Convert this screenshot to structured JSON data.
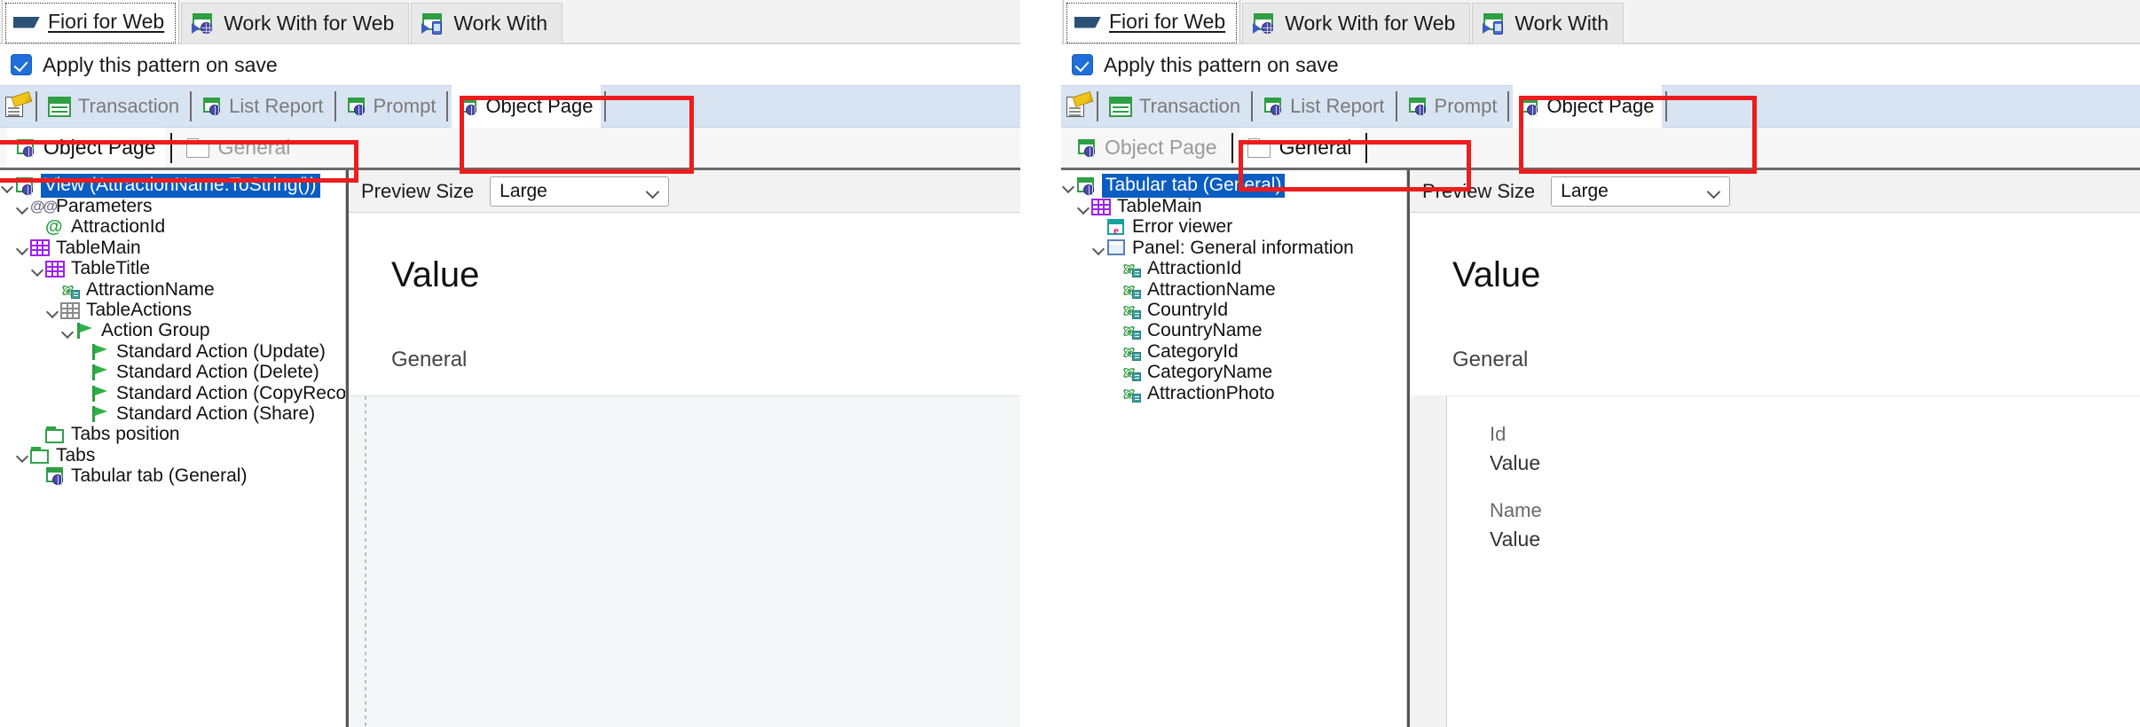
{
  "tabs": [
    {
      "label": "Fiori for Web",
      "icon": "fiori-icon",
      "active": true
    },
    {
      "label": "Work With for Web",
      "icon": "work-with-web-icon",
      "active": false
    },
    {
      "label": "Work With",
      "icon": "work-with-icon",
      "active": false
    }
  ],
  "checkbox": {
    "label": "Apply this pattern on save",
    "checked": true
  },
  "pattern_toolbar": {
    "settings_icon": "pattern-settings-icon",
    "items": [
      {
        "label": "Transaction",
        "icon": "transaction-grid-icon",
        "selected": false
      },
      {
        "label": "List Report",
        "icon": "list-report-icon",
        "selected": false
      },
      {
        "label": "Prompt",
        "icon": "prompt-icon",
        "selected": false
      },
      {
        "label": "Object Page",
        "icon": "object-page-icon",
        "selected": true
      }
    ]
  },
  "breadcrumb_left": [
    {
      "label": "Object Page",
      "icon": "object-page-icon",
      "active": true
    },
    {
      "label": "General",
      "icon": "folder-icon",
      "active": false
    }
  ],
  "breadcrumb_right": [
    {
      "label": "Object Page",
      "icon": "object-page-icon",
      "active": false
    },
    {
      "label": "General",
      "icon": "folder-icon",
      "active": true
    }
  ],
  "tree_left": [
    {
      "label": "View (AttractionName.ToString())",
      "icon": "object-page-icon",
      "indent": 0,
      "chevron": true,
      "selected": true
    },
    {
      "label": "Parameters",
      "icon": "parameters-icon",
      "indent": 1,
      "chevron": true,
      "selected": false
    },
    {
      "label": "AttractionId",
      "icon": "parameter-at-icon",
      "indent": 2,
      "chevron": false,
      "selected": false
    },
    {
      "label": "TableMain",
      "icon": "table-grid-icon",
      "indent": 1,
      "chevron": true,
      "selected": false
    },
    {
      "label": "TableTitle",
      "icon": "table-grid-icon",
      "indent": 2,
      "chevron": true,
      "selected": false
    },
    {
      "label": "AttractionName",
      "icon": "attribute-icon",
      "indent": 3,
      "chevron": false,
      "selected": false
    },
    {
      "label": "TableActions",
      "icon": "table-grid-gray-icon",
      "indent": 3,
      "chevron": true,
      "selected": false
    },
    {
      "label": "Action Group",
      "icon": "flag-icon",
      "indent": 4,
      "chevron": true,
      "selected": false
    },
    {
      "label": "Standard Action (Update)",
      "icon": "flag-icon",
      "indent": 5,
      "chevron": false,
      "selected": false
    },
    {
      "label": "Standard Action (Delete)",
      "icon": "flag-icon",
      "indent": 5,
      "chevron": false,
      "selected": false
    },
    {
      "label": "Standard Action (CopyRecor",
      "icon": "flag-icon",
      "indent": 5,
      "chevron": false,
      "selected": false
    },
    {
      "label": "Standard Action (Share)",
      "icon": "flag-icon",
      "indent": 5,
      "chevron": false,
      "selected": false
    },
    {
      "label": "Tabs position",
      "icon": "folder-green-icon",
      "indent": 2,
      "chevron": false,
      "selected": false
    },
    {
      "label": "Tabs",
      "icon": "folder-green-icon",
      "indent": 1,
      "chevron": true,
      "selected": false
    },
    {
      "label": "Tabular tab (General)",
      "icon": "object-page-icon",
      "indent": 2,
      "chevron": false,
      "selected": false
    }
  ],
  "tree_right": [
    {
      "label": "Tabular tab (General)",
      "icon": "object-page-icon",
      "indent": 0,
      "chevron": true,
      "selected": true
    },
    {
      "label": "TableMain",
      "icon": "table-grid-icon",
      "indent": 1,
      "chevron": true,
      "selected": false
    },
    {
      "label": "Error viewer",
      "icon": "error-viewer-icon",
      "indent": 2,
      "chevron": false,
      "selected": false
    },
    {
      "label": "Panel: General information",
      "icon": "panel-icon",
      "indent": 2,
      "chevron": true,
      "selected": false
    },
    {
      "label": "AttractionId",
      "icon": "attribute-icon",
      "indent": 3,
      "chevron": false,
      "selected": false
    },
    {
      "label": "AttractionName",
      "icon": "attribute-icon",
      "indent": 3,
      "chevron": false,
      "selected": false
    },
    {
      "label": "CountryId",
      "icon": "attribute-icon",
      "indent": 3,
      "chevron": false,
      "selected": false
    },
    {
      "label": "CountryName",
      "icon": "attribute-icon",
      "indent": 3,
      "chevron": false,
      "selected": false
    },
    {
      "label": "CategoryId",
      "icon": "attribute-icon",
      "indent": 3,
      "chevron": false,
      "selected": false
    },
    {
      "label": "CategoryName",
      "icon": "attribute-icon",
      "indent": 3,
      "chevron": false,
      "selected": false
    },
    {
      "label": "AttractionPhoto",
      "icon": "attribute-icon",
      "indent": 3,
      "chevron": false,
      "selected": false
    }
  ],
  "preview_left": {
    "size_label": "Preview Size",
    "size_value": "Large",
    "title": "Value",
    "section": "General"
  },
  "preview_right": {
    "size_label": "Preview Size",
    "size_value": "Large",
    "title": "Value",
    "section": "General",
    "fields": [
      {
        "label": "Id",
        "value": "Value"
      },
      {
        "label": "Name",
        "value": "Value"
      }
    ]
  },
  "colors": {
    "highlight": "#ee1c1c",
    "selection": "#0a5dc2",
    "toolbar": "#d9e4f2",
    "accent_green": "#2f9e44",
    "accent_purple": "#a020f0"
  }
}
